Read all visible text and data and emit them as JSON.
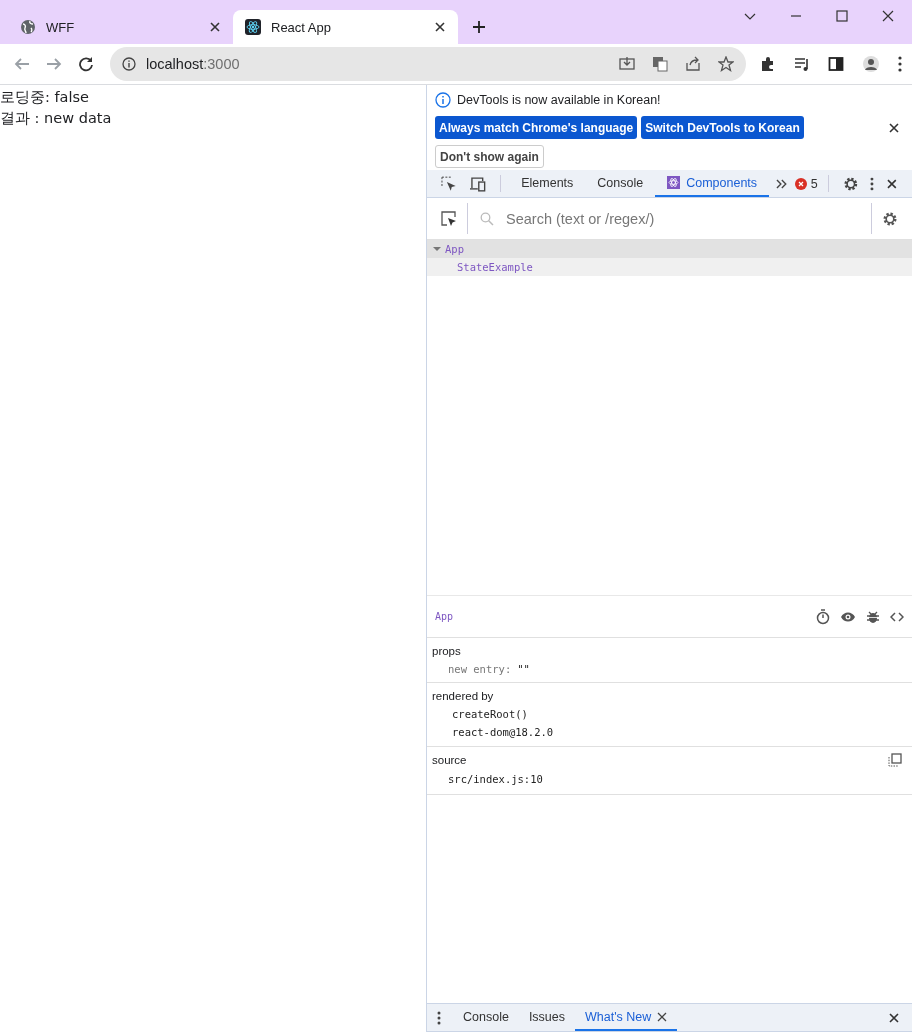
{
  "browser": {
    "tabs": [
      {
        "title": "WFF",
        "selected": false,
        "kind": "globe"
      },
      {
        "title": "React App",
        "selected": true,
        "kind": "react"
      }
    ],
    "address": {
      "host": "localhost",
      "port": ":3000"
    }
  },
  "page": {
    "lines": [
      "로딩중: false",
      "결과 : new data"
    ]
  },
  "devtools": {
    "infobar": {
      "message": "DevTools is now available in Korean!",
      "buttons": [
        "Always match Chrome's language",
        "Switch DevTools to Korean"
      ],
      "dismiss": "Don't show again"
    },
    "panel_tabs": [
      {
        "label": "Elements",
        "selected": false
      },
      {
        "label": "Console",
        "selected": false
      },
      {
        "label": "Components",
        "selected": true
      }
    ],
    "error_count": "5",
    "search": {
      "placeholder": "Search (text or /regex/)"
    },
    "tree": [
      {
        "name": "App",
        "expanded": true,
        "selected": true,
        "children": [
          {
            "name": "StateExample",
            "selected": false
          }
        ]
      }
    ],
    "inspector": {
      "component": "App",
      "sections": [
        {
          "kind": "props",
          "title": "props",
          "rows": [
            {
              "key": "new entry:",
              "value": "\"\""
            }
          ]
        },
        {
          "kind": "list",
          "title": "rendered by",
          "rows": [
            {
              "text": "createRoot()"
            },
            {
              "text": "react-dom@18.2.0"
            }
          ]
        },
        {
          "kind": "source",
          "title": "source",
          "rows": [
            {
              "text": "src/index.js:10"
            }
          ]
        }
      ]
    },
    "drawer_tabs": [
      {
        "label": "Console",
        "selected": false,
        "closable": false
      },
      {
        "label": "Issues",
        "selected": false,
        "closable": false
      },
      {
        "label": "What's New",
        "selected": true,
        "closable": true
      }
    ]
  }
}
